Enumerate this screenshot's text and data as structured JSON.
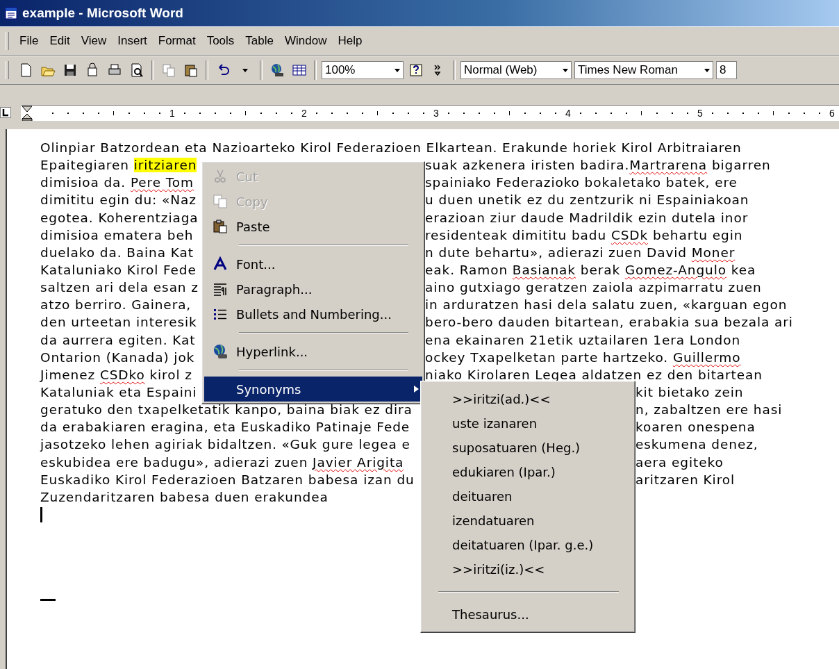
{
  "window": {
    "title": "example - Microsoft Word"
  },
  "menu_bar": [
    "File",
    "Edit",
    "View",
    "Insert",
    "Format",
    "Tools",
    "Table",
    "Window",
    "Help"
  ],
  "toolbar": {
    "zoom": "100%",
    "style": "Normal (Web)",
    "font": "Times New Roman",
    "size": "8"
  },
  "ruler": {
    "numbers": [
      "1",
      "2",
      "3",
      "4",
      "5",
      "6"
    ]
  },
  "document": {
    "lines": [
      {
        "kind": "full",
        "left": [
          {
            "kind": "plain",
            "text": "Olinpiar Batzordean eta Nazioarteko Kirol Federazioen Elkartean. Erakunde horiek Kirol Arbitraiaren"
          }
        ]
      },
      {
        "kind": "menu",
        "left": [
          {
            "kind": "plain",
            "text": "Epaitegiaren "
          },
          {
            "kind": "highlight",
            "text": "iritziaren"
          }
        ],
        "right": [
          {
            "kind": "plain",
            "text": "suak azkenera iristen badira."
          },
          {
            "kind": "misspelled",
            "text": "Martrarena"
          },
          {
            "kind": "plain",
            "text": " bigarren"
          }
        ]
      },
      {
        "kind": "menu",
        "left": [
          {
            "kind": "plain",
            "text": "dimisioa da. "
          },
          {
            "kind": "misspelled",
            "text": "Pere Tom"
          }
        ],
        "right": [
          {
            "kind": "plain",
            "text": "spainiako Federazioko bokaletako batek, ere"
          }
        ]
      },
      {
        "kind": "menu",
        "left": [
          {
            "kind": "plain",
            "text": "dimititu egin du: «Naz"
          }
        ],
        "right": [
          {
            "kind": "plain",
            "text": "u duen unetik ez du zentzurik ni Espainiakoan"
          }
        ]
      },
      {
        "kind": "menu",
        "left": [
          {
            "kind": "plain",
            "text": "egotea. Koherentziaga"
          }
        ],
        "right": [
          {
            "kind": "plain",
            "text": "erazioan ziur daude Madrildik ezin dutela inor"
          }
        ]
      },
      {
        "kind": "menu",
        "left": [
          {
            "kind": "plain",
            "text": "dimisioa ematera beh"
          }
        ],
        "right": [
          {
            "kind": "plain",
            "text": "residenteak dimititu badu "
          },
          {
            "kind": "misspelled",
            "text": "CSDk"
          },
          {
            "kind": "plain",
            "text": " behartu egin"
          }
        ]
      },
      {
        "kind": "menu",
        "left": [
          {
            "kind": "plain",
            "text": "duelako da. Baina Kat"
          }
        ],
        "right": [
          {
            "kind": "plain",
            "text": "n dute behartu», adierazi zuen David "
          },
          {
            "kind": "misspelled",
            "text": "Moner"
          }
        ]
      },
      {
        "kind": "menu",
        "left": [
          {
            "kind": "plain",
            "text": "Kataluniako Kirol Fede"
          }
        ],
        "right": [
          {
            "kind": "plain",
            "text": "eak. Ramon "
          },
          {
            "kind": "misspelled",
            "text": "Basianak"
          },
          {
            "kind": "plain",
            "text": " berak "
          },
          {
            "kind": "misspelled",
            "text": "Gomez-Angulo"
          },
          {
            "kind": "plain",
            "text": " kea"
          }
        ]
      },
      {
        "kind": "menu",
        "left": [
          {
            "kind": "plain",
            "text": "saltzen ari dela esan z"
          }
        ],
        "right": [
          {
            "kind": "plain",
            "text": "aino gutxiago geratzen zaiola azpimarratu zuen"
          }
        ]
      },
      {
        "kind": "menu",
        "left": [
          {
            "kind": "plain",
            "text": "atzo berriro. Gainera,"
          }
        ],
        "right": [
          {
            "kind": "plain",
            "text": "in arduratzen hasi dela salatu zuen, «karguan egon"
          }
        ]
      },
      {
        "kind": "menu",
        "left": [
          {
            "kind": "plain",
            "text": "den urteetan interesik"
          }
        ],
        "right": [
          {
            "kind": "plain",
            "text": "bero-bero dauden bitartean, erabakia sua bezala ari"
          }
        ]
      },
      {
        "kind": "menu",
        "left": [
          {
            "kind": "plain",
            "text": "da aurrera egiten. Kat"
          }
        ],
        "right": [
          {
            "kind": "plain",
            "text": "ena ekainaren 21etik uztailaren 1era London"
          }
        ]
      },
      {
        "kind": "menu",
        "left": [
          {
            "kind": "plain",
            "text": "Ontarion (Kanada) jok"
          }
        ],
        "right": [
          {
            "kind": "plain",
            "text": "ockey Txapelketan parte hartzeko. "
          },
          {
            "kind": "misspelled",
            "text": "Guillermo"
          }
        ]
      },
      {
        "kind": "menu",
        "left": [
          {
            "kind": "plain",
            "text": "Jimenez "
          },
          {
            "kind": "misspelled",
            "text": "CSDko"
          },
          {
            "kind": "plain",
            "text": " kirol z"
          }
        ],
        "right": [
          {
            "kind": "plain",
            "text": "niako Kirolaren Legea aldatzen ez den bitartean"
          }
        ]
      },
      {
        "kind": "submenu",
        "left": [
          {
            "kind": "plain",
            "text": "Kataluniak eta Espaini"
          }
        ],
        "right": [
          {
            "kind": "plain",
            "text": "kit bietako zein"
          }
        ]
      },
      {
        "kind": "submenu",
        "left": [
          {
            "kind": "plain",
            "text": "geratuko den txapelketatik kanpo, baina biak ez dira"
          }
        ],
        "right": [
          {
            "kind": "plain",
            "text": "n, zabaltzen ere hasi"
          }
        ]
      },
      {
        "kind": "submenu",
        "left": [
          {
            "kind": "plain",
            "text": "da erabakiaren eragina, eta Euskadiko Patinaje Fede"
          }
        ],
        "right": [
          {
            "kind": "plain",
            "text": "koaren onespena"
          }
        ]
      },
      {
        "kind": "submenu",
        "left": [
          {
            "kind": "plain",
            "text": "jasotzeko lehen agiriak bidaltzen. «Guk gure legea e"
          }
        ],
        "right": [
          {
            "kind": "plain",
            "text": "eskumena denez,"
          }
        ]
      },
      {
        "kind": "submenu",
        "left": [
          {
            "kind": "plain",
            "text": "eskubidea ere badugu», adierazi zuen "
          },
          {
            "kind": "misspelled",
            "text": "Javier Arigita"
          }
        ],
        "right": [
          {
            "kind": "plain",
            "text": "aera egiteko"
          }
        ]
      },
      {
        "kind": "submenu",
        "left": [
          {
            "kind": "plain",
            "text": "Euskadiko Kirol Federazioen Batzaren babesa izan du"
          }
        ],
        "right": [
          {
            "kind": "plain",
            "text": "aritzaren Kirol"
          }
        ]
      },
      {
        "kind": "full",
        "left": [
          {
            "kind": "plain",
            "text": "Zuzendaritzaren babesa duen erakundea"
          }
        ]
      }
    ]
  },
  "context_menu": {
    "items": [
      {
        "kind": "item",
        "label": "Cut",
        "disabled": true,
        "selected": false
      },
      {
        "kind": "item",
        "label": "Copy",
        "disabled": true,
        "selected": false
      },
      {
        "kind": "item",
        "label": "Paste",
        "disabled": false,
        "selected": false
      },
      {
        "kind": "separator"
      },
      {
        "kind": "item",
        "label": "Font...",
        "disabled": false,
        "selected": false
      },
      {
        "kind": "item",
        "label": "Paragraph...",
        "disabled": false,
        "selected": false
      },
      {
        "kind": "item",
        "label": "Bullets and Numbering...",
        "disabled": false,
        "selected": false
      },
      {
        "kind": "separator"
      },
      {
        "kind": "item",
        "label": "Hyperlink...",
        "disabled": false,
        "selected": false
      },
      {
        "kind": "separator"
      },
      {
        "kind": "submenu",
        "label": "Synonyms",
        "disabled": false,
        "selected": true
      }
    ]
  },
  "synonyms_menu": {
    "items": [
      {
        "kind": "item",
        "label": ">>iritzi(ad.)<<"
      },
      {
        "kind": "item",
        "label": "uste izanaren"
      },
      {
        "kind": "item",
        "label": "suposatuaren (Heg.)"
      },
      {
        "kind": "item",
        "label": "edukiaren (Ipar.)"
      },
      {
        "kind": "item",
        "label": "deituaren"
      },
      {
        "kind": "item",
        "label": "izendatuaren"
      },
      {
        "kind": "item",
        "label": "deitatuaren (Ipar. g.e.)"
      },
      {
        "kind": "item",
        "label": ">>iritzi(iz.)<<"
      },
      {
        "kind": "separator"
      },
      {
        "kind": "item",
        "label": "Thesaurus..."
      }
    ]
  }
}
